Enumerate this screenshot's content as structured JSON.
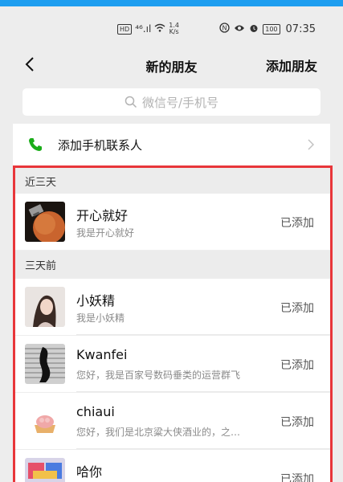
{
  "status_bar": {
    "sim_badge": "HD",
    "signal": "⁴⁶.ıl",
    "speed_value": "1.4",
    "speed_unit": "K/s",
    "battery": "100",
    "time": "07:35"
  },
  "nav": {
    "title": "新的朋友",
    "action_label": "添加朋友"
  },
  "search": {
    "placeholder": "微信号/手机号"
  },
  "add_contacts": {
    "label": "添加手机联系人"
  },
  "sections": [
    {
      "header": "近三天"
    },
    {
      "header": "三天前"
    }
  ],
  "requests": [
    {
      "name": "开心就好",
      "message": "我是开心就好",
      "status": "已添加"
    },
    {
      "name": "小妖精",
      "message": "我是小妖精",
      "status": "已添加"
    },
    {
      "name": "Kwanfei",
      "message": "您好，我是百家号数码垂类的运营群飞",
      "status": "已添加"
    },
    {
      "name": "chiaui",
      "message": "您好，我们是北京粱大侠酒业的，之…",
      "status": "已添加"
    },
    {
      "name": "哈你",
      "message": "",
      "status": "已添加"
    }
  ],
  "colors": {
    "highlight_border": "#e8363a",
    "phone_icon": "#1aad19",
    "top_bar": "#1e9ef0"
  }
}
